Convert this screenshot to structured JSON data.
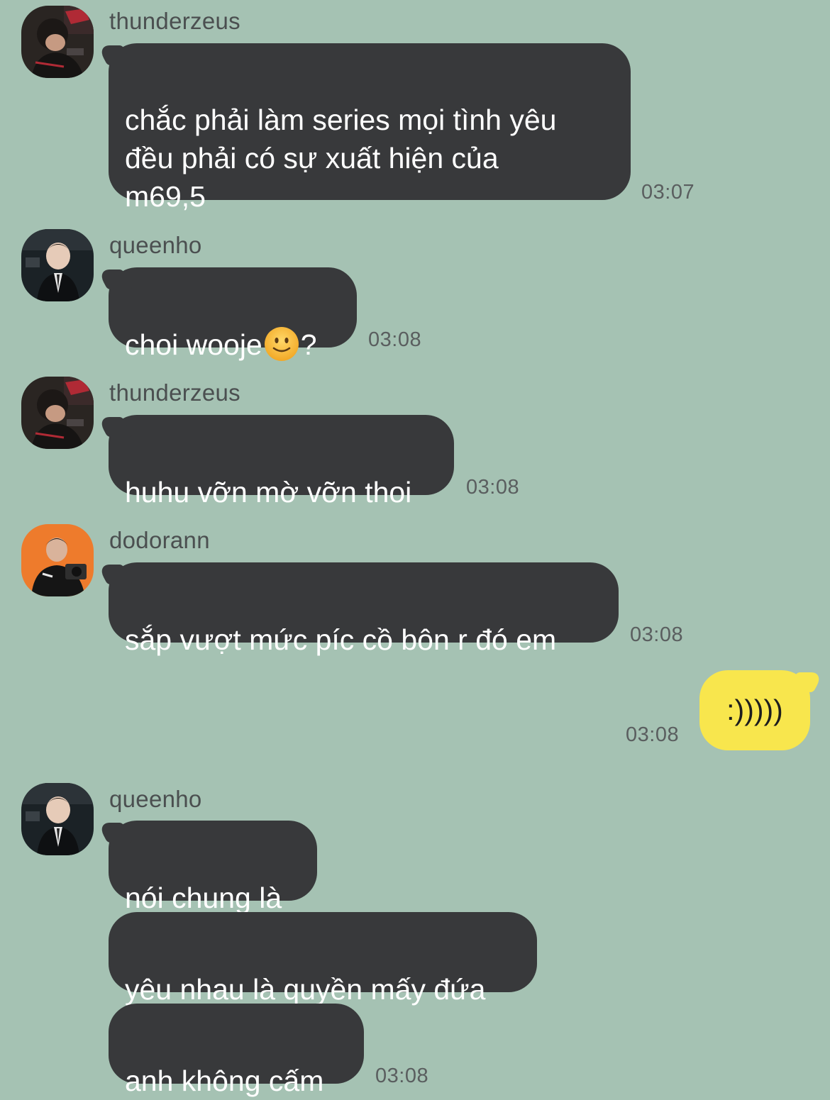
{
  "messages": [
    {
      "sender": "thunderzeus",
      "text": "chắc phải làm series mọi tình yêu\nđều phải có sự xuất hiện của\nm69,5",
      "time": "03:07"
    },
    {
      "sender": "queenho",
      "text_before": "choi wooje",
      "emoji": "slightly-smiling-face-icon",
      "text_after": "?",
      "time": "03:08"
    },
    {
      "sender": "thunderzeus",
      "text": "huhu vỡn mờ vỡn thoi",
      "time": "03:08"
    },
    {
      "sender": "dodorann",
      "text": "sắp vượt mức píc cồ bôn r đó em",
      "time": "03:08"
    },
    {
      "sender": "me",
      "text": ":)))))",
      "time": "03:08"
    },
    {
      "sender": "queenho",
      "texts": [
        "nói chung là",
        "yêu nhau là quyền mấy đứa",
        "anh không cấm"
      ],
      "time": "03:08"
    }
  ],
  "colors": {
    "background": "#a5c2b3",
    "incoming_bubble": "#38393b",
    "outgoing_bubble": "#f8e64d"
  }
}
